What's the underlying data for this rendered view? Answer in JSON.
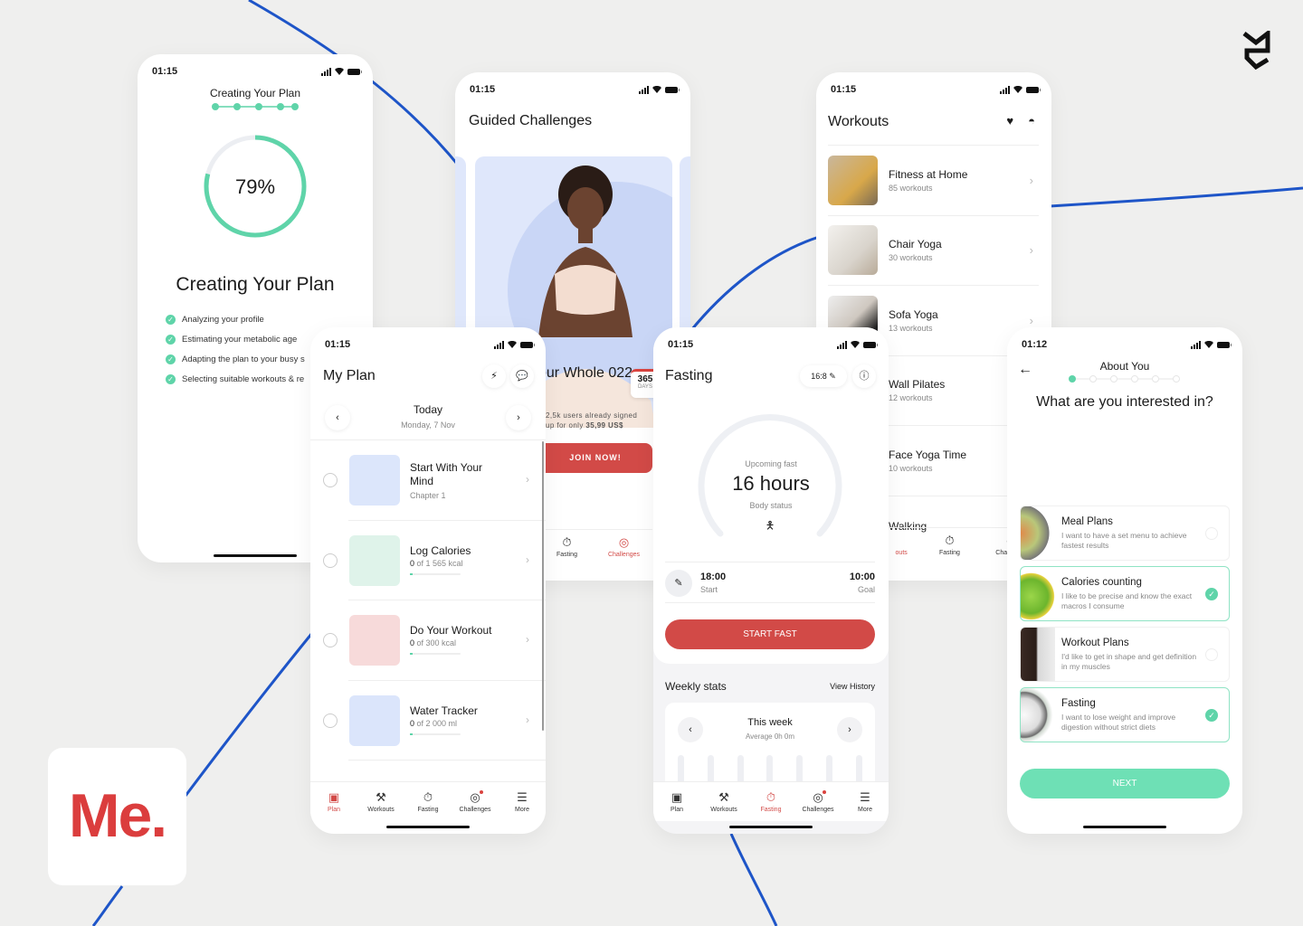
{
  "brand": {
    "app_logo_text": "Me.",
    "studio_logo": "s-monogram-logo",
    "colors": {
      "accent_red": "#d24a47",
      "mint": "#5fd4a9",
      "background": "#efefee",
      "curve_blue": "#1e55c8"
    }
  },
  "creating_plan": {
    "time": "01:15",
    "header": "Creating Your Plan",
    "progress_percent": 79,
    "progress_label": "79%",
    "steps_completed": 5,
    "steps_total": 5,
    "title": "Creating Your Plan",
    "checklist": [
      "Analyzing your profile",
      "Estimating your metabolic age",
      "Adapting the plan to your busy s",
      "Selecting suitable workouts & re"
    ]
  },
  "guided": {
    "time": "01:15",
    "title": "Guided Challenges",
    "challenge_title": "our Whole 022",
    "days_number": "365",
    "days_label": "DAYS",
    "signed_line1": "2,5k users already signed",
    "signed_line2_prefix": "up for only ",
    "signed_price": "35,99 US$",
    "join_label": "JOIN NOW!",
    "tabs": [
      {
        "label": "Fasting",
        "icon": "stopwatch-icon"
      },
      {
        "label": "Challenges",
        "icon": "challenges-icon",
        "active": true
      }
    ]
  },
  "workouts": {
    "time": "01:15",
    "title": "Workouts",
    "header_icons": [
      "heart-icon",
      "broadcast-icon"
    ],
    "items": [
      {
        "name": "Fitness at Home",
        "count": "85 workouts"
      },
      {
        "name": "Chair Yoga",
        "count": "30 workouts"
      },
      {
        "name": "Sofa Yoga",
        "count": "13 workouts"
      },
      {
        "name": "Wall Pilates",
        "count": "12 workouts"
      },
      {
        "name": "Face Yoga Time",
        "count": "10 workouts"
      },
      {
        "name": "Walking",
        "count": ""
      }
    ],
    "tabs": [
      {
        "label": "outs"
      },
      {
        "label": "Fasting"
      },
      {
        "label": "Challenges"
      }
    ]
  },
  "my_plan": {
    "time": "01:15",
    "title": "My Plan",
    "today": "Today",
    "date": "Monday, 7 Nov",
    "items": [
      {
        "title": "Start With Your Mind",
        "sub": "Chapter 1",
        "has_bar": false
      },
      {
        "title": "Log Calories",
        "value": "0",
        "sub": " of 1 565 kcal",
        "has_bar": true,
        "progress": 0
      },
      {
        "title": "Do Your Workout",
        "value": "0",
        "sub": " of 300 kcal",
        "has_bar": true,
        "progress": 0
      },
      {
        "title": "Water Tracker",
        "value": "0",
        "sub": " of 2 000 ml",
        "has_bar": true,
        "progress": 0
      }
    ],
    "tabs": [
      {
        "label": "Plan",
        "icon": "plan-icon",
        "active": true
      },
      {
        "label": "Workouts",
        "icon": "dumbbell-icon"
      },
      {
        "label": "Fasting",
        "icon": "stopwatch-icon"
      },
      {
        "label": "Challenges",
        "icon": "challenges-icon",
        "badge": true
      },
      {
        "label": "More",
        "icon": "menu-icon"
      }
    ]
  },
  "fasting": {
    "time": "01:15",
    "title": "Fasting",
    "plan_pill": "16:8",
    "upcoming_label": "Upcoming fast",
    "hours": "16 hours",
    "body_status": "Body status",
    "start_time": "18:00",
    "start_label": "Start",
    "goal_time": "10:00",
    "goal_label": "Goal",
    "start_button": "START FAST",
    "weekly_title": "Weekly stats",
    "view_history": "View History",
    "week_title": "This week",
    "week_avg": "Average 0h 0m",
    "tabs": [
      {
        "label": "Plan",
        "icon": "plan-icon"
      },
      {
        "label": "Workouts",
        "icon": "dumbbell-icon"
      },
      {
        "label": "Fasting",
        "icon": "stopwatch-icon",
        "active": true
      },
      {
        "label": "Challenges",
        "icon": "challenges-icon",
        "badge": true
      },
      {
        "label": "More",
        "icon": "menu-icon"
      }
    ]
  },
  "about_you": {
    "time": "01:12",
    "header": "About You",
    "step_current": 1,
    "steps_total": 6,
    "question": "What are you interested in?",
    "options": [
      {
        "title": "Meal Plans",
        "desc": "I want to have a set menu to achieve fastest results",
        "selected": false
      },
      {
        "title": "Calories counting",
        "desc": "I like to be precise and know the exact macros I consume",
        "selected": true
      },
      {
        "title": "Workout Plans",
        "desc": "I'd like to get in shape and get definition in my muscles",
        "selected": false
      },
      {
        "title": "Fasting",
        "desc": "I want to lose weight and improve digestion without strict diets",
        "selected": true
      }
    ],
    "next_label": "NEXT"
  }
}
